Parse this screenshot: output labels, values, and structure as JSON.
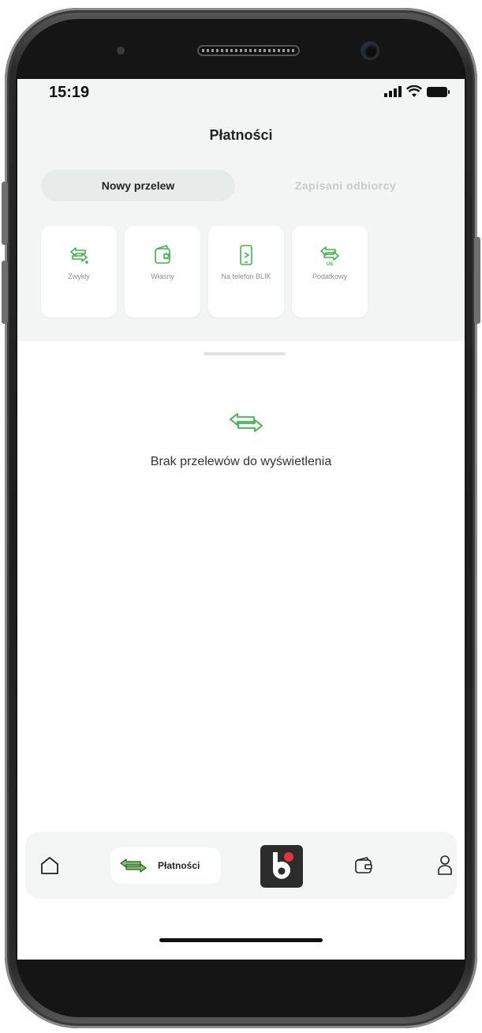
{
  "status_bar": {
    "time": "15:19"
  },
  "header": {
    "title": "Płatności"
  },
  "tabs": [
    {
      "label": "Nowy przelew",
      "active": true
    },
    {
      "label": "Zapisani odbiorcy",
      "active": false
    }
  ],
  "transfer_types": [
    {
      "label": "Zwykły",
      "icon": "transfer-arrows-icon"
    },
    {
      "label": "Własny",
      "icon": "wallet-icon"
    },
    {
      "label": "Na telefon BLIK",
      "icon": "phone-icon"
    },
    {
      "label": "Podatkowy",
      "icon": "tax-transfer-icon"
    }
  ],
  "empty_state": {
    "message": "Brak przelewów do wyświetlenia",
    "icon": "transfer-arrows-icon"
  },
  "bottom_nav": {
    "home_icon": "home-icon",
    "payments_label": "Płatności",
    "blik_icon": "blik-logo",
    "wallet_icon": "wallet-icon",
    "profile_icon": "profile-icon"
  },
  "colors": {
    "accent_green": "#3bb54a",
    "panel_bg": "#f2f5f4",
    "blik_bg": "#2c2c2c",
    "blik_dot": "#e8333c"
  }
}
